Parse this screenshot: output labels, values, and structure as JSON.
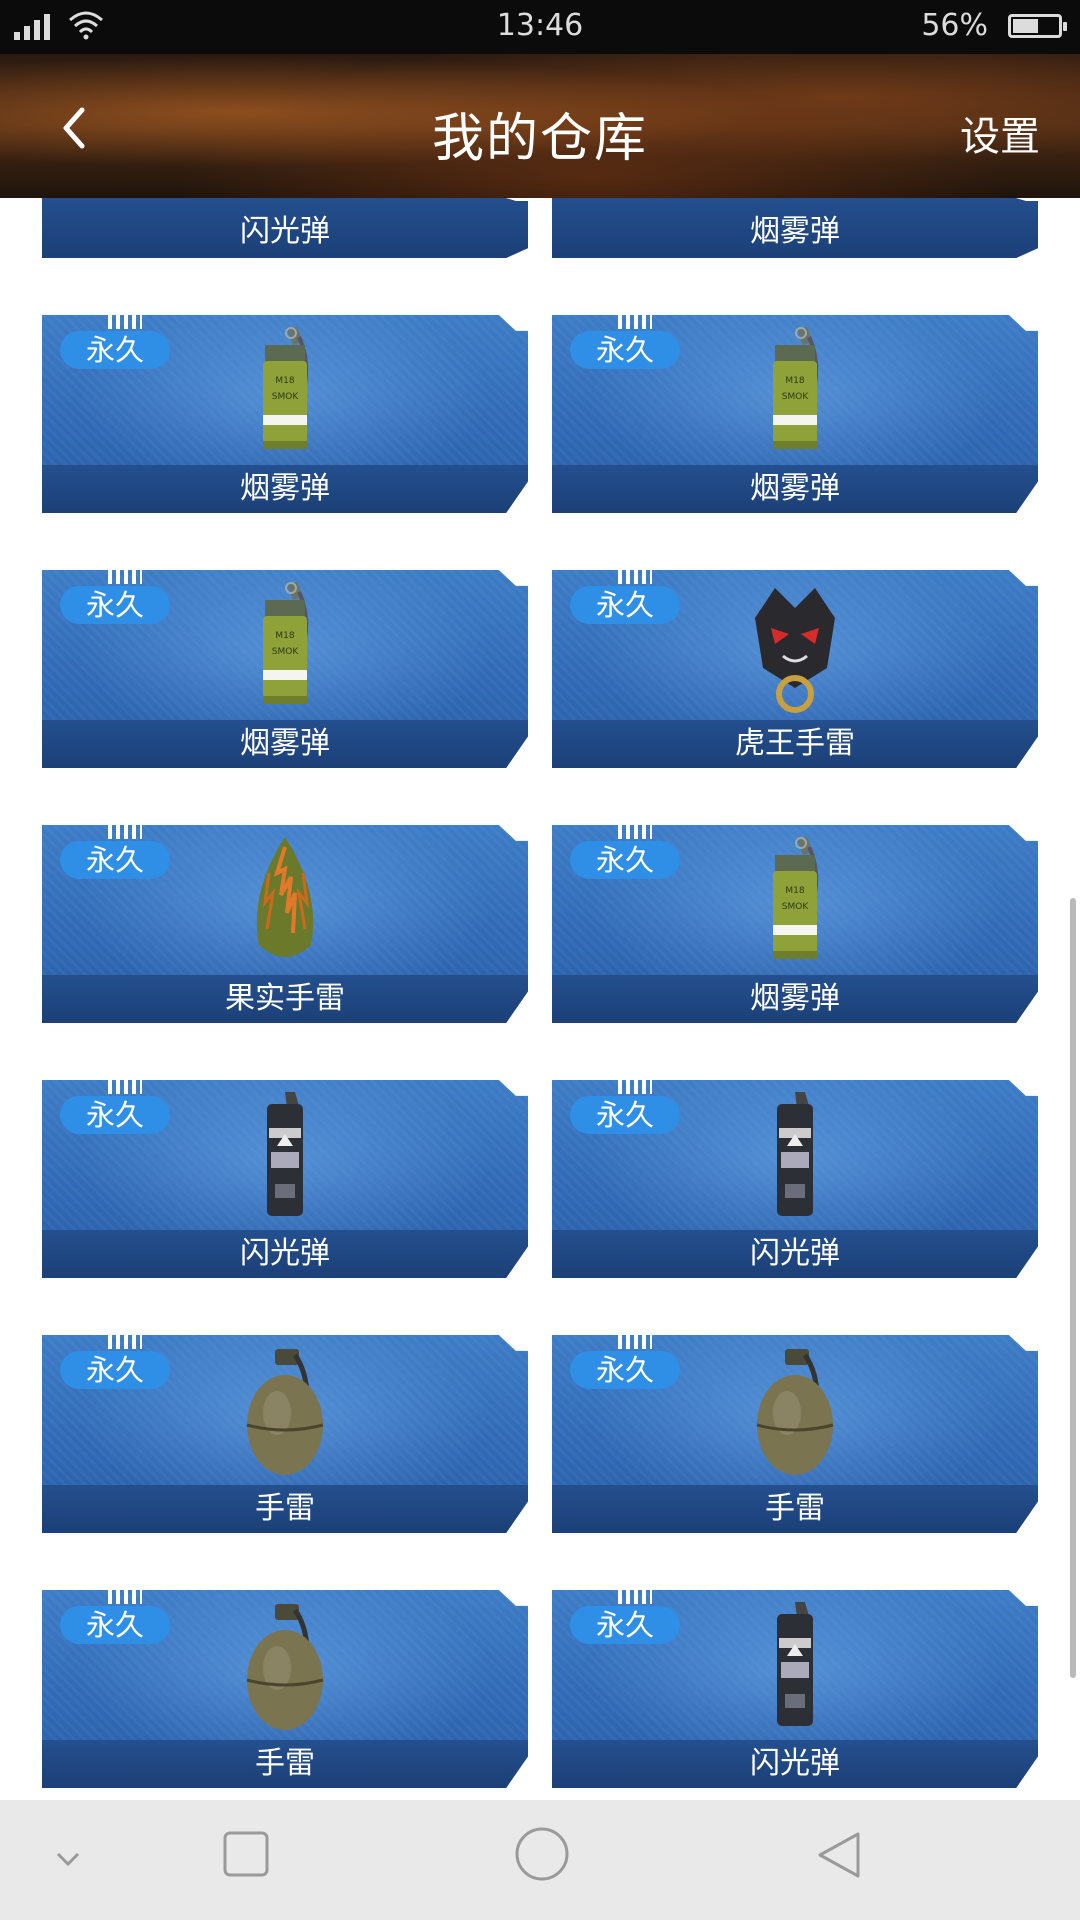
{
  "status_bar": {
    "time": "13:46",
    "battery": "56%",
    "battery_level": 0.56
  },
  "header": {
    "title": "我的仓库",
    "settings_label": "设置"
  },
  "colors": {
    "card_blue": "#2f68b4",
    "badge_blue": "#2f8fe6",
    "header_brown": "#4a2a14"
  },
  "items": [
    {
      "name": "闪光弹",
      "partial": true
    },
    {
      "name": "烟雾弹",
      "partial": true
    },
    {
      "name": "烟雾弹",
      "badge": "永久",
      "icon": "smoke-grenade-icon"
    },
    {
      "name": "烟雾弹",
      "badge": "永久",
      "icon": "smoke-grenade-icon"
    },
    {
      "name": "烟雾弹",
      "badge": "永久",
      "icon": "smoke-grenade-icon"
    },
    {
      "name": "虎王手雷",
      "badge": "永久",
      "icon": "tiger-king-grenade-icon"
    },
    {
      "name": "果实手雷",
      "badge": "永久",
      "icon": "fruit-grenade-icon"
    },
    {
      "name": "烟雾弹",
      "badge": "永久",
      "icon": "smoke-grenade-icon"
    },
    {
      "name": "闪光弹",
      "badge": "永久",
      "icon": "flashbang-icon"
    },
    {
      "name": "闪光弹",
      "badge": "永久",
      "icon": "flashbang-icon"
    },
    {
      "name": "手雷",
      "badge": "永久",
      "icon": "frag-grenade-icon"
    },
    {
      "name": "手雷",
      "badge": "永久",
      "icon": "frag-grenade-icon"
    },
    {
      "name": "手雷",
      "badge": "永久",
      "icon": "frag-grenade-icon"
    },
    {
      "name": "闪光弹",
      "badge": "永久",
      "icon": "flashbang-icon"
    }
  ]
}
